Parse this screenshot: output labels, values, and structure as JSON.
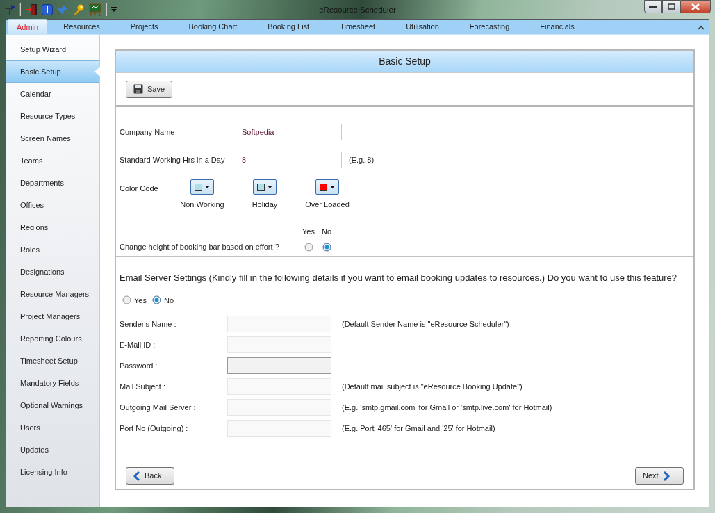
{
  "window": {
    "title": "eResource Scheduler"
  },
  "tabs": [
    {
      "label": "Admin",
      "selected": true
    },
    {
      "label": "Resources",
      "selected": false
    },
    {
      "label": "Projects",
      "selected": false
    },
    {
      "label": "Booking Chart",
      "selected": false
    },
    {
      "label": "Booking List",
      "selected": false
    },
    {
      "label": "Timesheet",
      "selected": false
    },
    {
      "label": "Utilisation",
      "selected": false
    },
    {
      "label": "Forecasting",
      "selected": false
    },
    {
      "label": "Financials",
      "selected": false
    }
  ],
  "sidebar": {
    "items": [
      {
        "label": "Setup Wizard",
        "selected": false
      },
      {
        "label": "Basic Setup",
        "selected": true
      },
      {
        "label": "Calendar",
        "selected": false
      },
      {
        "label": "Resource Types",
        "selected": false
      },
      {
        "label": "Screen Names",
        "selected": false
      },
      {
        "label": "Teams",
        "selected": false
      },
      {
        "label": "Departments",
        "selected": false
      },
      {
        "label": "Offices",
        "selected": false
      },
      {
        "label": "Regions",
        "selected": false
      },
      {
        "label": "Roles",
        "selected": false
      },
      {
        "label": "Designations",
        "selected": false
      },
      {
        "label": "Resource Managers",
        "selected": false
      },
      {
        "label": "Project Managers",
        "selected": false
      },
      {
        "label": "Reporting Colours",
        "selected": false
      },
      {
        "label": "Timesheet Setup",
        "selected": false
      },
      {
        "label": "Mandatory Fields",
        "selected": false
      },
      {
        "label": "Optional Warnings",
        "selected": false
      },
      {
        "label": "Users",
        "selected": false
      },
      {
        "label": "Updates",
        "selected": false
      },
      {
        "label": "Licensing Info",
        "selected": false
      }
    ]
  },
  "panel": {
    "title": "Basic Setup",
    "save_button": "Save"
  },
  "company_name": {
    "label": "Company Name",
    "value": "Softpedia"
  },
  "working_hours": {
    "label": "Standard Working Hrs in a Day",
    "value": "8",
    "hint": "(E.g. 8)"
  },
  "color_code": {
    "label": "Color Code",
    "items": [
      {
        "label": "Non Working",
        "color": "#b0e0e6"
      },
      {
        "label": "Holiday",
        "color": "#b0e0e6"
      },
      {
        "label": "Over Loaded",
        "color": "#ff0000"
      }
    ]
  },
  "booking_bar": {
    "question": "Change height of booking bar based on effort ?",
    "options": [
      {
        "label": "Yes",
        "selected": false
      },
      {
        "label": "No",
        "selected": true
      }
    ]
  },
  "email": {
    "intro": "Email Server Settings (Kindly fill in the following details if you want to email booking updates to resources.) Do you want to use this feature?",
    "options": [
      {
        "label": "Yes",
        "selected": false
      },
      {
        "label": "No",
        "selected": true
      }
    ],
    "fields": [
      {
        "label": "Sender's Name :",
        "kind": "text",
        "hint": "(Default Sender Name is \"eResource Scheduler\")"
      },
      {
        "label": "E-Mail ID :",
        "kind": "text"
      },
      {
        "label": "Password :",
        "kind": "password"
      },
      {
        "label": "Mail Subject :",
        "kind": "text",
        "hint": "(Default mail subject is \"eResource Booking Update\")"
      },
      {
        "label": "Outgoing Mail Server :",
        "kind": "text",
        "hint": "(E.g. 'smtp.gmail.com' for Gmail or 'smtp.live.com' for Hotmail)"
      },
      {
        "label": "Port No (Outgoing) :",
        "kind": "text",
        "hint": "(E.g. Port '465' for Gmail and '25' for Hotmail)"
      }
    ]
  },
  "footer": {
    "back": "Back",
    "next": "Next"
  }
}
